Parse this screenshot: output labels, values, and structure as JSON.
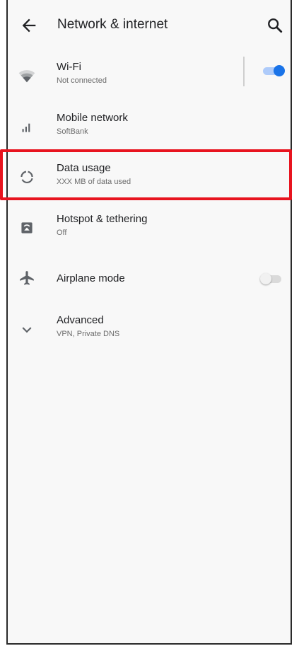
{
  "header": {
    "title": "Network & internet",
    "back_icon": "arrow-left-icon",
    "search_icon": "search-icon"
  },
  "items": [
    {
      "label": "Wi-Fi",
      "sub": "Not connected",
      "icon": "wifi-icon",
      "toggle": "on"
    },
    {
      "label": "Mobile network",
      "sub": "SoftBank",
      "icon": "signal-icon"
    },
    {
      "label": "Data usage",
      "sub": "XXX MB of data used",
      "icon": "data-usage-icon"
    },
    {
      "label": "Hotspot & tethering",
      "sub": "Off",
      "icon": "hotspot-icon"
    },
    {
      "label": "Airplane mode",
      "icon": "airplane-icon",
      "toggle": "off"
    },
    {
      "label": "Advanced",
      "sub": "VPN, Private DNS",
      "icon": "chevron-down-icon"
    }
  ],
  "colors": {
    "accent": "#1a73e8",
    "highlight": "#e8141f",
    "icon": "#5f6368",
    "text": "#202124"
  }
}
